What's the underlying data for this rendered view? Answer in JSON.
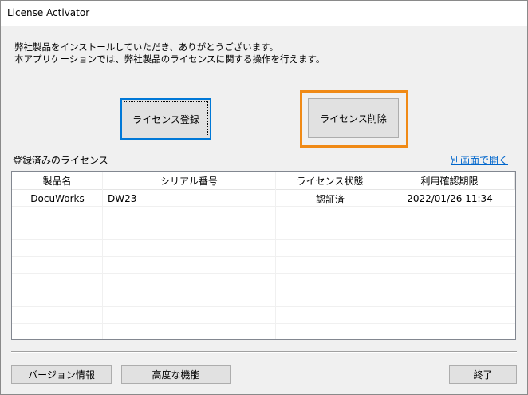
{
  "window": {
    "title": "License Activator"
  },
  "intro": {
    "line1": "弊社製品をインストールしていただき、ありがとうございます。",
    "line2": "本アプリケーションでは、弊社製品のライセンスに関する操作を行えます。"
  },
  "buttons": {
    "register": "ライセンス登録",
    "delete": "ライセンス削除",
    "version": "バージョン情報",
    "advanced": "高度な機能",
    "exit": "終了"
  },
  "registered": {
    "label": "登録済みのライセンス",
    "open_link": "別画面で開く"
  },
  "table": {
    "headers": [
      "製品名",
      "シリアル番号",
      "ライセンス状態",
      "利用確認期限"
    ],
    "rows": [
      [
        "DocuWorks",
        "DW23-",
        "認証済",
        "2022/01/26 11:34"
      ]
    ]
  },
  "colors": {
    "highlight": "#f08a16",
    "link": "#0066cc",
    "default_button_border": "#0078d7"
  }
}
